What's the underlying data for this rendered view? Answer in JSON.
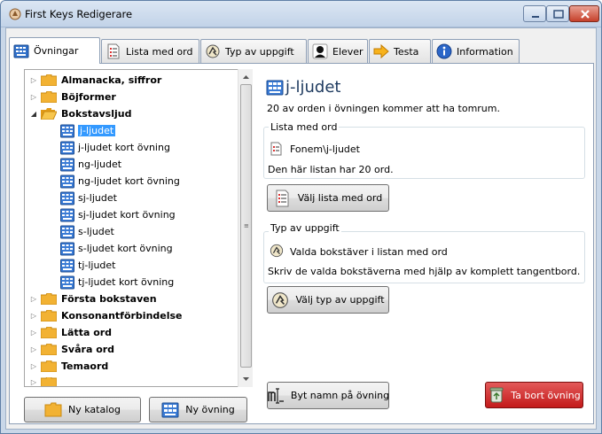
{
  "window": {
    "title": "First Keys Redigerare"
  },
  "tabs": [
    {
      "label": "Övningar",
      "icon": "exercise-icon",
      "active": true
    },
    {
      "label": "Lista med ord",
      "icon": "word-list-icon",
      "active": false
    },
    {
      "label": "Typ av uppgift",
      "icon": "task-type-icon",
      "active": false
    },
    {
      "label": "Elever",
      "icon": "students-icon",
      "active": false
    },
    {
      "label": "Testa",
      "icon": "arrow-right-icon",
      "active": false
    },
    {
      "label": "Information",
      "icon": "info-icon",
      "active": false
    }
  ],
  "tree": {
    "items": [
      {
        "label": "Almanacka, siffror",
        "kind": "folder",
        "expanded": false
      },
      {
        "label": "Böjformer",
        "kind": "folder",
        "expanded": false
      },
      {
        "label": "Bokstavsljud",
        "kind": "folder",
        "expanded": true
      },
      {
        "label": "j-ljudet",
        "kind": "exercise",
        "selected": true
      },
      {
        "label": "j-ljudet kort övning",
        "kind": "exercise"
      },
      {
        "label": "ng-ljudet",
        "kind": "exercise"
      },
      {
        "label": "ng-ljudet kort övning",
        "kind": "exercise"
      },
      {
        "label": "sj-ljudet",
        "kind": "exercise"
      },
      {
        "label": "sj-ljudet kort övning",
        "kind": "exercise"
      },
      {
        "label": "s-ljudet",
        "kind": "exercise"
      },
      {
        "label": "s-ljudet kort övning",
        "kind": "exercise"
      },
      {
        "label": "tj-ljudet",
        "kind": "exercise"
      },
      {
        "label": "tj-ljudet kort övning",
        "kind": "exercise"
      },
      {
        "label": "Första bokstaven",
        "kind": "folder",
        "expanded": false
      },
      {
        "label": "Konsonantförbindelse",
        "kind": "folder",
        "expanded": false
      },
      {
        "label": "Lätta ord",
        "kind": "folder",
        "expanded": false
      },
      {
        "label": "Svåra ord",
        "kind": "folder",
        "expanded": false
      },
      {
        "label": "Temaord",
        "kind": "folder",
        "expanded": false
      }
    ]
  },
  "left_buttons": {
    "new_folder": "Ny katalog",
    "new_exercise": "Ny övning"
  },
  "detail": {
    "title": "j-ljudet",
    "summary": "20 av orden i övningen kommer att ha tomrum.",
    "word_list": {
      "header": "Lista med ord",
      "path": "Fonem\\j-ljudet",
      "count_text": "Den här listan har 20 ord.",
      "choose_button": "Välj lista med ord"
    },
    "task_type": {
      "header": "Typ av uppgift",
      "name": "Valda bokstäver i listan med ord",
      "description": "Skriv de valda bokstäverna med hjälp av komplett tangentbord.",
      "choose_button": "Välj typ av uppgift"
    },
    "rename_button": "Byt namn på övning",
    "delete_button": "Ta bort övning"
  },
  "colors": {
    "selection": "#3399ff",
    "danger": "#c31a1a",
    "folder": "#f2b233",
    "title_text": "#1e3a5f"
  }
}
